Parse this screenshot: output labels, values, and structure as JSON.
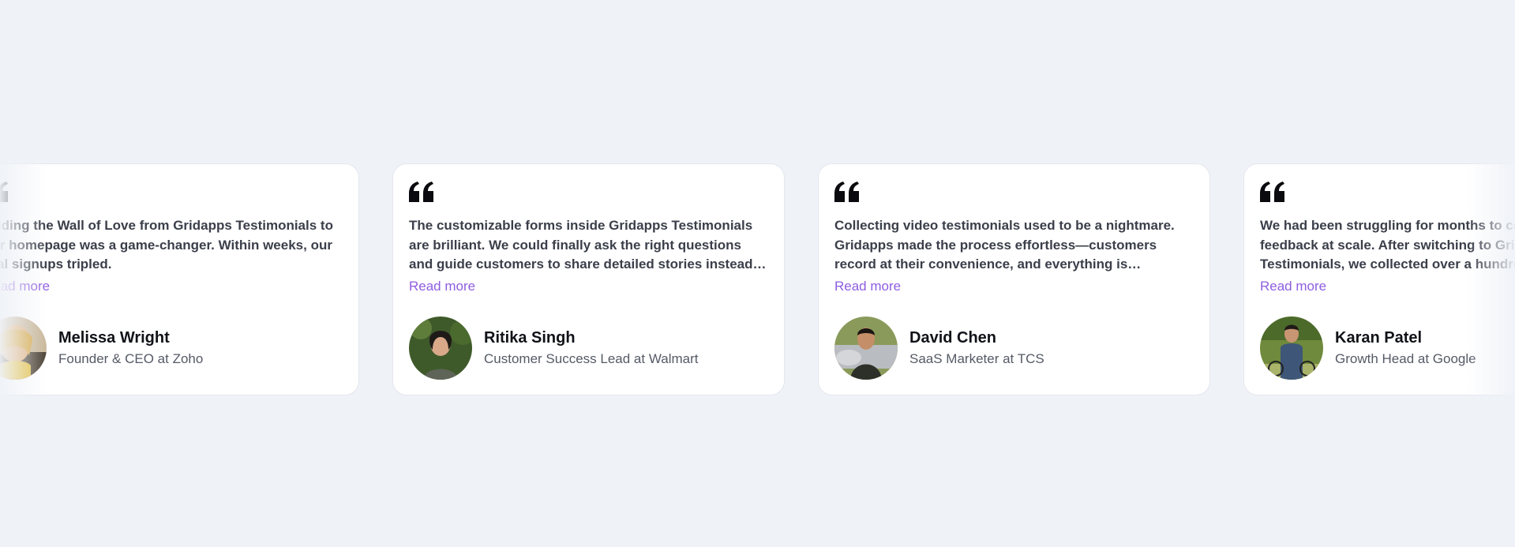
{
  "colors": {
    "background": "#eff2f7",
    "card": "#ffffff",
    "accent": "#8f5de0",
    "quote_text": "#3b3f4a",
    "name": "#101218",
    "role": "#555a66"
  },
  "testimonials": [
    {
      "quote": "Adding the Wall of Love from Gridapps Testimonials to our homepage was a game-changer. Within weeks, our trial signups tripled.",
      "read_more": "Read more",
      "name": "Melissa Wright",
      "role": "Founder & CEO at Zoho",
      "icon": "quote-icon"
    },
    {
      "quote": "The customizable forms inside Gridapps Testimonials are brilliant. We could finally ask the right questions and guide customers to share detailed stories instead of generic one-liners.",
      "read_more": "Read more",
      "name": "Ritika Singh",
      "role": "Customer Success Lead at Walmart",
      "icon": "quote-icon"
    },
    {
      "quote": "Collecting video testimonials used to be a nightmare. Gridapps made the process effortless—customers record at their convenience, and everything is organized in one place.",
      "read_more": "Read more",
      "name": "David Chen",
      "role": "SaaS Marketer at TCS",
      "icon": "quote-icon"
    },
    {
      "quote": "We had been struggling for months to collect customer feedback at scale. After switching to Gridapps Testimonials, we collected over a hundred reviews.",
      "read_more": "Read more",
      "name": "Karan Patel",
      "role": "Growth Head at Google",
      "icon": "quote-icon"
    }
  ]
}
